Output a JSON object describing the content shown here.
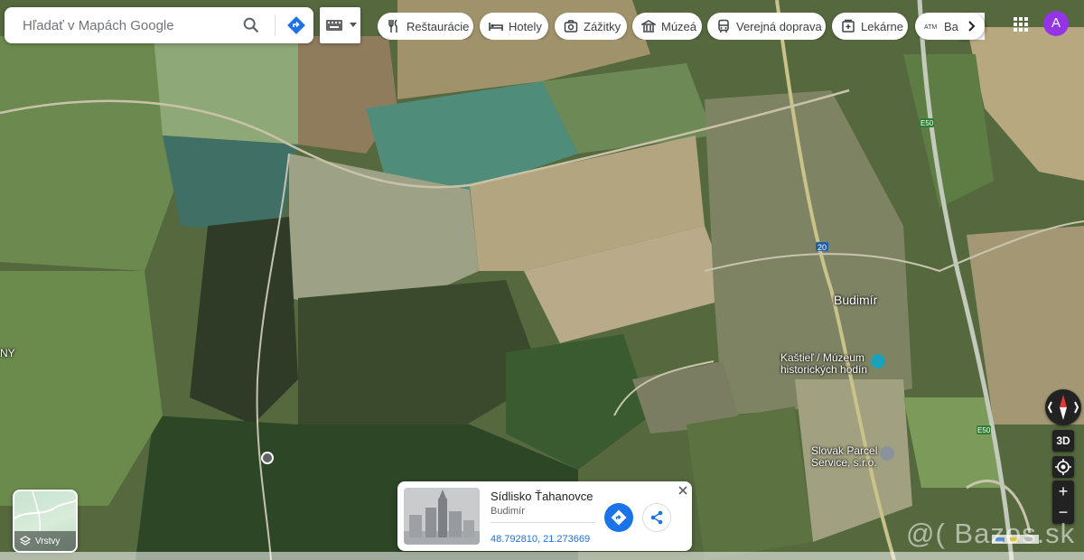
{
  "search": {
    "placeholder": "Hľadať v Mapách Google"
  },
  "categories": [
    {
      "label": "Reštaurácie",
      "icon": "fork-knife-icon"
    },
    {
      "label": "Hotely",
      "icon": "bed-icon"
    },
    {
      "label": "Zážitky",
      "icon": "camera-icon"
    },
    {
      "label": "Múzeá",
      "icon": "museum-icon"
    },
    {
      "label": "Verejná doprava",
      "icon": "bus-icon"
    },
    {
      "label": "Lekárne",
      "icon": "pharmacy-icon"
    },
    {
      "label": "Bar",
      "icon": "atm-icon"
    }
  ],
  "account": {
    "initial": "A",
    "color": "#9334e6"
  },
  "map": {
    "places": [
      {
        "label": "Budimír"
      },
      {
        "label": "Kaštieľ / Múzeum historických hodín"
      },
      {
        "label": "Slovak Parcel Service, s.r.o."
      },
      {
        "label": "NY"
      }
    ],
    "roads": [
      {
        "label": "20"
      },
      {
        "label": "E50"
      },
      {
        "label": "E50"
      }
    ]
  },
  "layers": {
    "label": "Vrstvy"
  },
  "controls": {
    "view3d": "3D",
    "zoom_in": "+",
    "zoom_out": "−"
  },
  "place_card": {
    "title": "Sídlisko Ťahanovce",
    "subtitle": "Budimír",
    "coordinates": "48.792810, 21.273669"
  },
  "watermark": "@( Bazos.sk"
}
